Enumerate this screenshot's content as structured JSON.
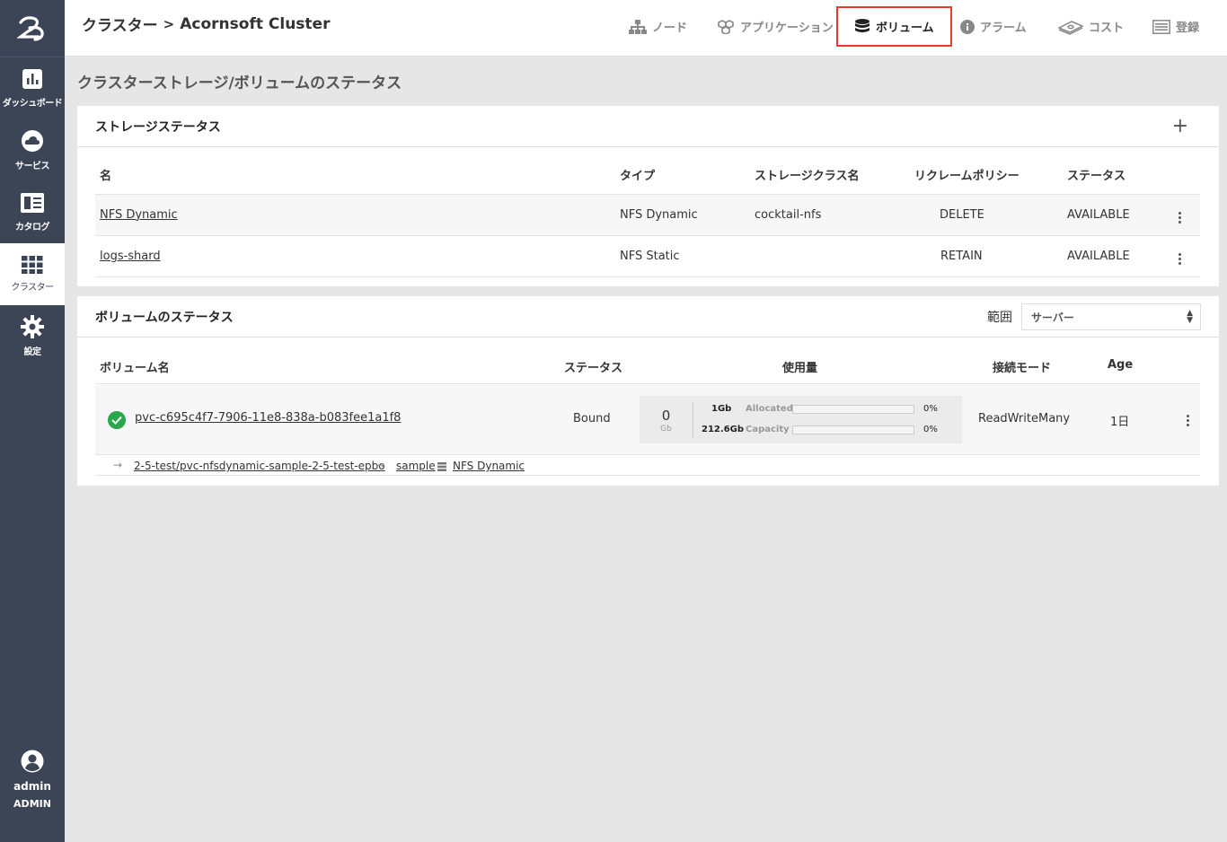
{
  "sidebar": {
    "items": [
      {
        "label": "ダッシュボード",
        "icon": "bar-chart-icon"
      },
      {
        "label": "サービス",
        "icon": "cloud-icon"
      },
      {
        "label": "カタログ",
        "icon": "catalog-icon"
      },
      {
        "label": "クラスター",
        "icon": "grid-icon"
      },
      {
        "label": "設定",
        "icon": "gear-icon"
      }
    ],
    "user": {
      "name": "admin",
      "role": "ADMIN"
    }
  },
  "header": {
    "breadcrumb_root": "クラスター",
    "breadcrumb_sep": ">",
    "breadcrumb_current": "Acornsoft Cluster",
    "nav": [
      {
        "label": "ノード",
        "icon": "sitemap-icon"
      },
      {
        "label": "アプリケーション",
        "icon": "cubes-icon"
      },
      {
        "label": "ボリューム",
        "icon": "database-icon",
        "active": true
      },
      {
        "label": "アラーム",
        "icon": "info-icon"
      },
      {
        "label": "コスト",
        "icon": "money-icon"
      },
      {
        "label": "登録",
        "icon": "list-icon"
      }
    ]
  },
  "page_title": "クラスターストレージ/ボリュームのステータス",
  "storage": {
    "title": "ストレージステータス",
    "add_label": "+",
    "columns": [
      "名",
      "タイプ",
      "ストレージクラス名",
      "リクレームポリシー",
      "ステータス"
    ],
    "rows": [
      {
        "name": "NFS Dynamic",
        "type": "NFS Dynamic",
        "class": "cocktail-nfs",
        "policy": "DELETE",
        "status": "AVAILABLE"
      },
      {
        "name": "logs-shard",
        "type": "NFS Static",
        "class": "",
        "policy": "RETAIN",
        "status": "AVAILABLE"
      }
    ]
  },
  "volumes": {
    "title": "ボリュームのステータス",
    "range_label": "範囲",
    "range_value": "サーバー",
    "columns": [
      "ボリューム名",
      "ステータス",
      "使用量",
      "接続モード",
      "Age"
    ],
    "row": {
      "name": "pvc-c695c4f7-7906-11e8-838a-b083fee1a1f8",
      "status": "Bound",
      "used": "0",
      "used_unit": "Gb",
      "allocated_value": "1Gb",
      "allocated_label": "Allocated",
      "allocated_pct": "0%",
      "allocated_fraction": 0,
      "capacity_value": "212.6Gb",
      "capacity_label": "Capacity",
      "capacity_pct": "0%",
      "capacity_fraction": 0,
      "mode": "ReadWriteMany",
      "age": "1日"
    },
    "sub": {
      "claim": "2-5-test/pvc-nfsdynamic-sample-2-5-test-epbo",
      "app": "sample",
      "storage": "NFS Dynamic"
    }
  }
}
